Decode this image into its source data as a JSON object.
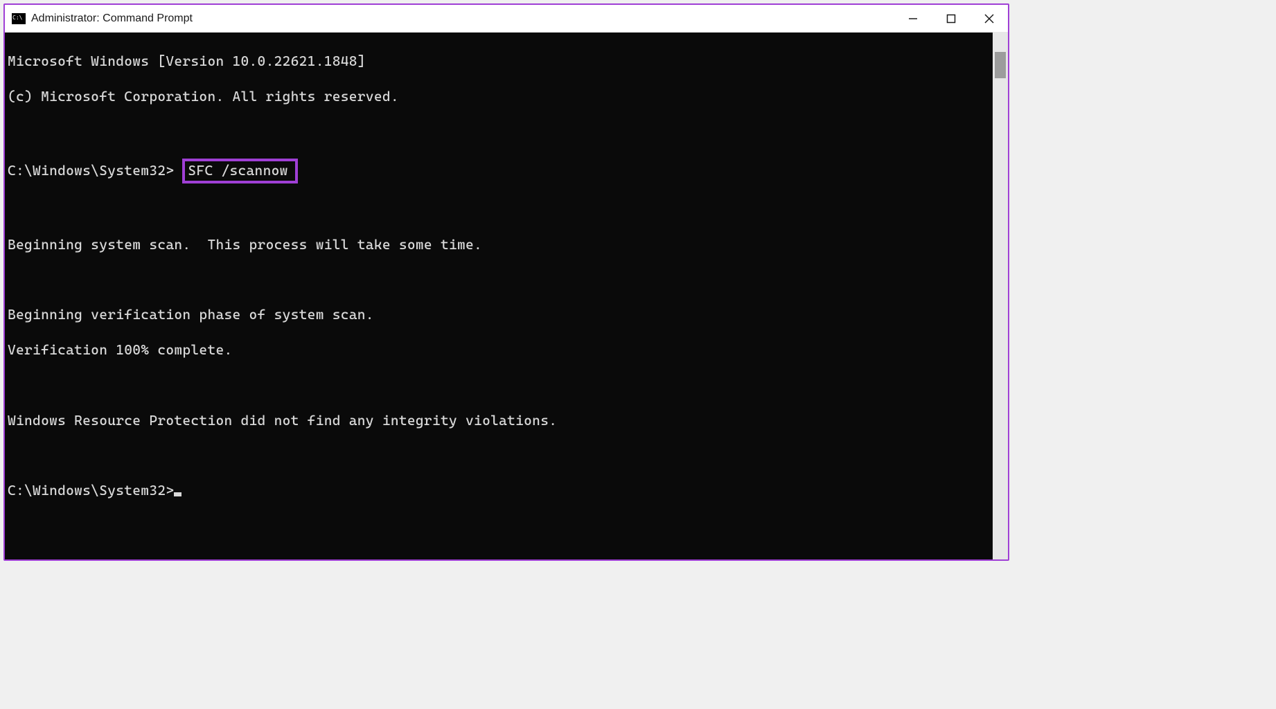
{
  "titlebar": {
    "title": "Administrator: Command Prompt"
  },
  "terminal": {
    "version_line": "Microsoft Windows [Version 10.0.22621.1848]",
    "copyright_line": "(c) Microsoft Corporation. All rights reserved.",
    "prompt1_path": "C:\\Windows\\System32>",
    "command_highlighted": "SFC /scannow",
    "scan_begin": "Beginning system scan.  This process will take some time.",
    "verify_begin": "Beginning verification phase of system scan.",
    "verify_done": "Verification 100% complete.",
    "result_line": "Windows Resource Protection did not find any integrity violations.",
    "prompt2_path": "C:\\Windows\\System32>"
  },
  "colors": {
    "accent": "#9f3fd5",
    "terminal_bg": "#0a0a0a",
    "terminal_fg": "#d8d8d8"
  }
}
